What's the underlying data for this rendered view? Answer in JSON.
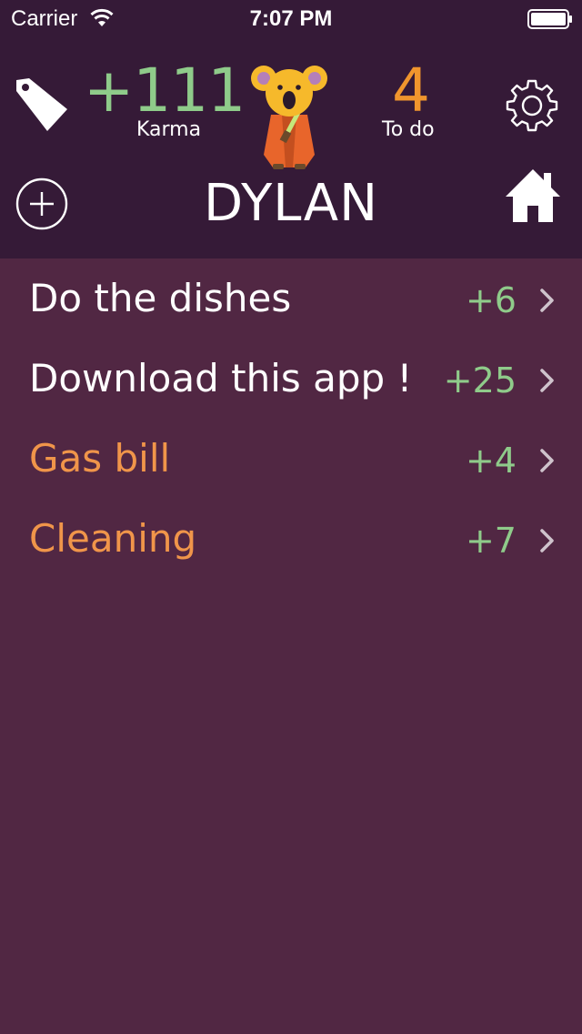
{
  "status_bar": {
    "carrier": "Carrier",
    "time": "7:07 PM",
    "wifi_icon": "wifi-icon",
    "battery_icon": "battery-icon"
  },
  "header": {
    "karma_value": "+111",
    "karma_label": "Karma",
    "todo_count": "4",
    "todo_label": "To do",
    "user_name": "DYLAN",
    "icons": [
      "tag-icon",
      "koala-mascot",
      "gear-icon",
      "add-circle-icon",
      "home-icon"
    ]
  },
  "tasks": [
    {
      "title": "Do the dishes",
      "points": "+6",
      "color": "#ffffff"
    },
    {
      "title": "Download this app !",
      "points": "+25",
      "color": "#ffffff"
    },
    {
      "title": "Gas bill",
      "points": "+4",
      "color": "#f0954a"
    },
    {
      "title": "Cleaning",
      "points": "+7",
      "color": "#f0954a"
    }
  ],
  "colors": {
    "header_bg": "#351a37",
    "list_bg": "#512743",
    "karma_green": "#8fcb8a",
    "todo_orange": "#f0952d",
    "task_orange": "#f0954a"
  }
}
